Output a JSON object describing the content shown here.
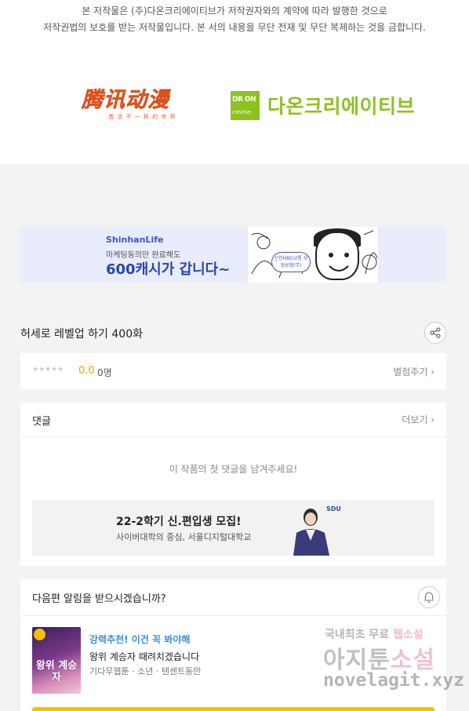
{
  "copyright": {
    "line1": "본 저작물은 (주)다온크리에이티브가 저작권자와의 계약에 따라 발행한 것으로",
    "line2": "저작권법의 보호를 받는 저작물입니다. 본 서의 내용을 무단 전재 및 무단 복제하는 것을 금합니다."
  },
  "logos": {
    "tencent_main": "腾讯动漫",
    "tencent_sub": "激 活 不 一 样 的 世 界",
    "daon_box_top": "DR ON",
    "daon_box_bottom": "CREATIVE",
    "daon_text": "다온크리에이티브",
    "daon_color": "#8dc21f",
    "tencent_color": "#f0622a"
  },
  "ad_banner": {
    "brand": "ShinhanLife",
    "sub": "마케팅동의만 완료해도",
    "headline": "600캐시가 갑니다~",
    "badge": "신한HBO교통 보험보험(무)"
  },
  "episode": {
    "title": "허세로 레벨업 하기 400화",
    "share_icon": "share-icon"
  },
  "rating": {
    "stars": "★★★★★",
    "value": "0.0",
    "count": "0명",
    "rate_link": "별점주기 ›"
  },
  "comments": {
    "header": "댓글",
    "more": "더보기 ›",
    "empty": "이 작품의 첫 댓글을 남겨주세요!",
    "ad": {
      "headline": "22-2학기 신.편입생 모집!",
      "sub": "사이버대학의 중심, 서울디지털대학교",
      "logo": "SDU"
    }
  },
  "notify": {
    "question": "다음편 알림을 받으시겠습니까?",
    "bell_icon": "bell-icon",
    "rec_tag": "강력추천! 이건 꼭 봐야해",
    "rec_title": "왕위 계승자 때려치겠습니다",
    "rec_meta": "기다무웹툰 · 소년 · 텐센트동만",
    "thumb_title": "왕위 계승자"
  },
  "watermark": {
    "line1_a": "국내최초 무료 ",
    "line1_b": "웹소설",
    "line2_a": "아지툰",
    "line2_b": "소설",
    "line3": "novelagit.xyz"
  }
}
